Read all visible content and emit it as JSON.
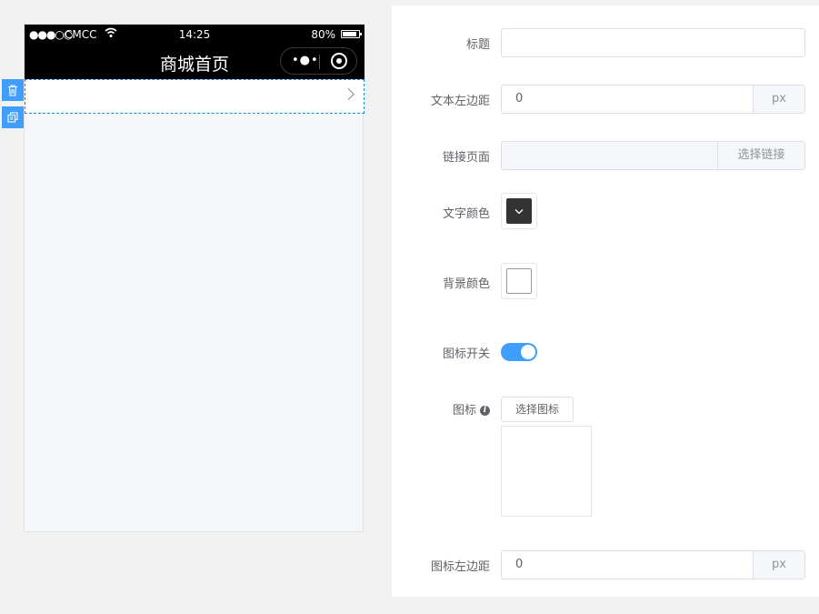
{
  "status_bar": {
    "signal": "●●●○○",
    "carrier": "CMCC",
    "time": "14:25",
    "battery": "80%"
  },
  "nav": {
    "title": "商城首页",
    "more_glyph": "•●•"
  },
  "form": {
    "title_label": "标题",
    "title_value": "",
    "text_left_label": "文本左边距",
    "text_left_value": "0",
    "text_left_unit": "px",
    "link_label": "链接页面",
    "link_value": "",
    "link_button": "选择链接",
    "text_color_label": "文字颜色",
    "text_color": "#333333",
    "bg_color_label": "背景颜色",
    "bg_color": "#ffffff",
    "icon_switch_label": "图标开关",
    "icon_switch_on": true,
    "icon_label": "图标",
    "icon_button": "选择图标",
    "icon_left_label": "图标左边距",
    "icon_left_value": "0",
    "icon_left_unit": "px"
  },
  "colors": {
    "accent": "#409eff",
    "selection_border": "#1e88e5"
  }
}
